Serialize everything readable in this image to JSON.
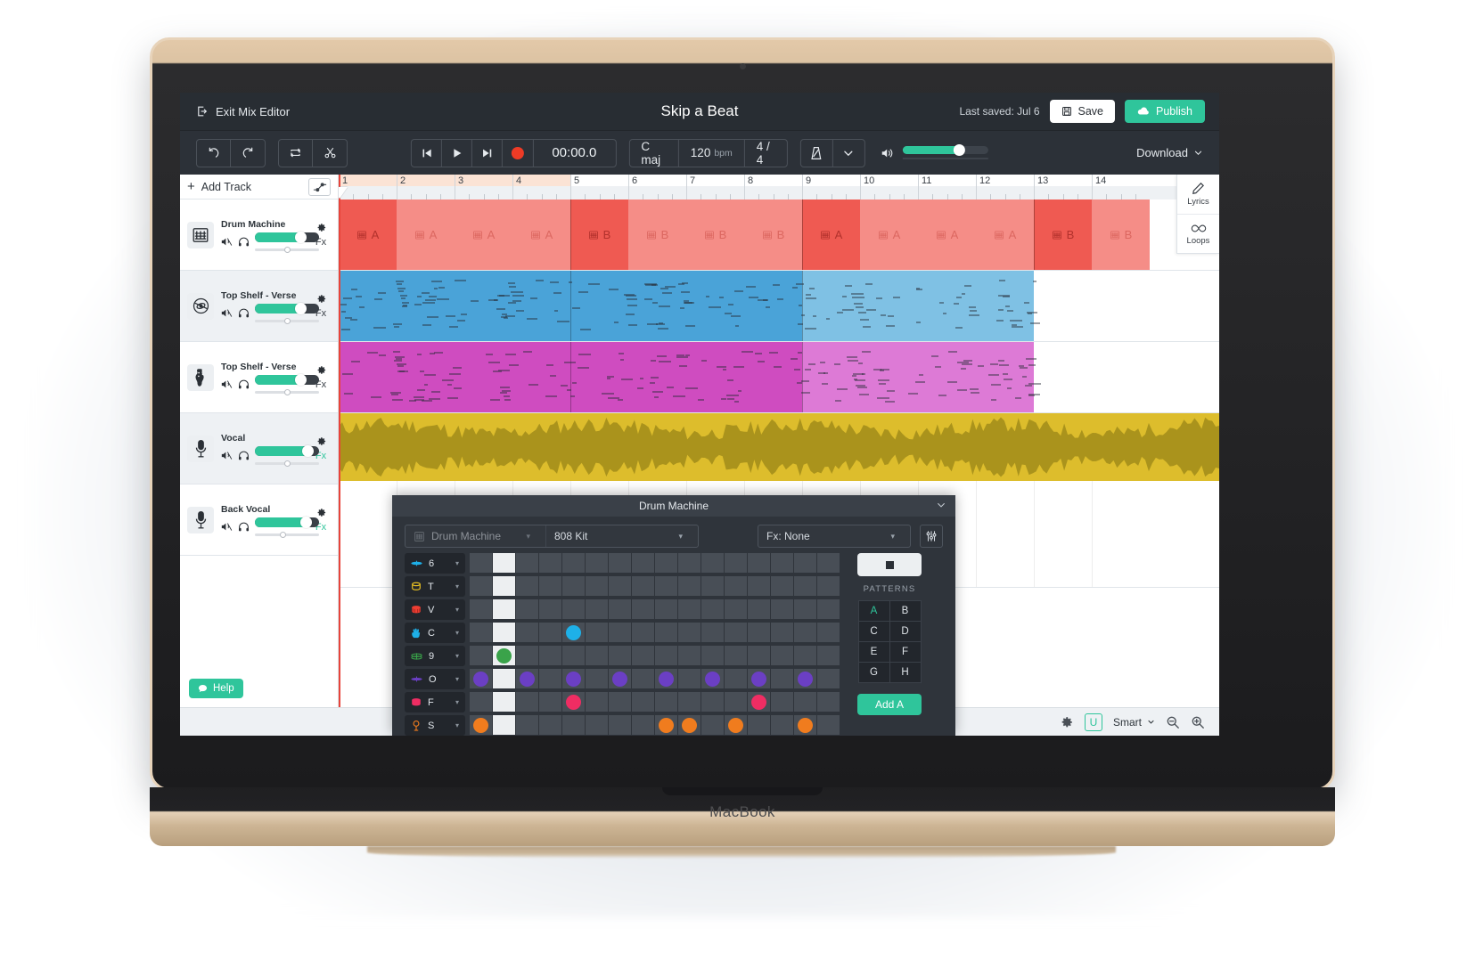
{
  "device": {
    "brand": "MacBook"
  },
  "topbar": {
    "exit_label": "Exit Mix Editor",
    "title": "Skip a Beat",
    "last_saved": "Last saved: Jul 6",
    "save_label": "Save",
    "publish_label": "Publish"
  },
  "transport": {
    "undo": "undo-icon",
    "redo": "redo-icon",
    "loop": "loop-icon",
    "cut": "scissors-icon",
    "skip_start": "skip-start-icon",
    "play": "play-icon",
    "skip_end": "skip-end-icon",
    "record": "record-icon",
    "time": "00:00.0",
    "key": "C maj",
    "bpm": "120",
    "bpm_unit": "bpm",
    "time_signature": "4 / 4",
    "metronome": "metronome-icon",
    "volume_percent": 66,
    "download_label": "Download"
  },
  "tracks_pane": {
    "add_track_label": "Add Track",
    "help_label": "Help",
    "tracks": [
      {
        "name": "Drum Machine",
        "icon": "drum-machine-icon",
        "volume": 72,
        "pan": 50,
        "fx_label": "Fx",
        "fx_active": false,
        "selected": true
      },
      {
        "name": "Top Shelf - Verse",
        "icon": "cymbal-icon",
        "volume": 72,
        "pan": 50,
        "fx_label": "Fx",
        "fx_active": false,
        "selected": false
      },
      {
        "name": "Top Shelf - Verse",
        "icon": "guitar-icon",
        "volume": 72,
        "pan": 50,
        "fx_label": "Fx",
        "fx_active": false,
        "selected": false
      },
      {
        "name": "Vocal",
        "icon": "microphone-icon",
        "volume": 82,
        "pan": 50,
        "fx_label": "Fx",
        "fx_active": true,
        "selected": false
      },
      {
        "name": "Back Vocal",
        "icon": "microphone-icon",
        "volume": 80,
        "pan": 44,
        "fx_label": "Fx",
        "fx_active": true,
        "selected": false
      }
    ]
  },
  "timeline": {
    "bars": [
      "1",
      "2",
      "3",
      "4",
      "5",
      "6",
      "7",
      "8",
      "9",
      "10",
      "11",
      "12",
      "13",
      "14"
    ],
    "loop_region_bars": [
      1,
      5
    ],
    "playhead_bar": 1,
    "drum_clips": [
      {
        "label": "A",
        "bar": 1,
        "strong": true
      },
      {
        "label": "A",
        "bar": 2,
        "strong": false
      },
      {
        "label": "A",
        "bar": 3,
        "strong": false
      },
      {
        "label": "A",
        "bar": 4,
        "strong": false
      },
      {
        "label": "B",
        "bar": 5,
        "strong": true
      },
      {
        "label": "B",
        "bar": 6,
        "strong": false
      },
      {
        "label": "B",
        "bar": 7,
        "strong": false
      },
      {
        "label": "B",
        "bar": 8,
        "strong": false
      },
      {
        "label": "A",
        "bar": 9,
        "strong": true
      },
      {
        "label": "A",
        "bar": 10,
        "strong": false
      },
      {
        "label": "A",
        "bar": 11,
        "strong": false
      },
      {
        "label": "A",
        "bar": 12,
        "strong": false
      },
      {
        "label": "B",
        "bar": 13,
        "strong": true
      },
      {
        "label": "B",
        "bar": 14,
        "strong": false
      }
    ]
  },
  "right_dock": {
    "items": [
      {
        "label": "Lyrics",
        "icon": "pencil-icon"
      },
      {
        "label": "Loops",
        "icon": "infinity-icon"
      }
    ]
  },
  "bottombar": {
    "settings_icon": "gear-icon",
    "badge": "U",
    "mode_label": "Smart",
    "zoom_out_icon": "zoom-out-icon",
    "zoom_in_icon": "zoom-in-icon"
  },
  "drum_machine": {
    "title": "Drum Machine",
    "collapse_icon": "chevron-down-icon",
    "instrument_select": "Drum Machine",
    "kit_select": "808 Kit",
    "fx_select": "Fx: None",
    "eq_icon": "mixer-icon",
    "stop_icon": "stop-icon",
    "patterns_label": "PATTERNS",
    "patterns": [
      "A",
      "B",
      "C",
      "D",
      "E",
      "F",
      "G",
      "H"
    ],
    "active_pattern": "A",
    "add_label": "Add A",
    "steps": 16,
    "current_step": 2,
    "rows": [
      {
        "name": "6",
        "icon": "crash-icon",
        "color": "#1eb0e8",
        "steps": []
      },
      {
        "name": "T",
        "icon": "tom-icon",
        "color": "#e8c022",
        "steps": []
      },
      {
        "name": "V",
        "icon": "snare-icon",
        "color": "#ef3e33",
        "steps": []
      },
      {
        "name": "C",
        "icon": "clap-icon",
        "color": "#1eb0e8",
        "steps": [
          5
        ]
      },
      {
        "name": "9",
        "icon": "hihat-icon",
        "color": "#3aa34a",
        "steps": [
          2
        ]
      },
      {
        "name": "O",
        "icon": "openhat-icon",
        "color": "#6b3fc4",
        "steps": [
          1,
          3,
          5,
          7,
          9,
          11,
          13,
          15
        ]
      },
      {
        "name": "F",
        "icon": "kick-icon",
        "color": "#ef2d63",
        "steps": [
          5,
          13
        ]
      },
      {
        "name": "S",
        "icon": "sub-icon",
        "color": "#f07c1e",
        "steps": [
          1,
          9,
          10,
          12,
          15
        ]
      }
    ]
  }
}
